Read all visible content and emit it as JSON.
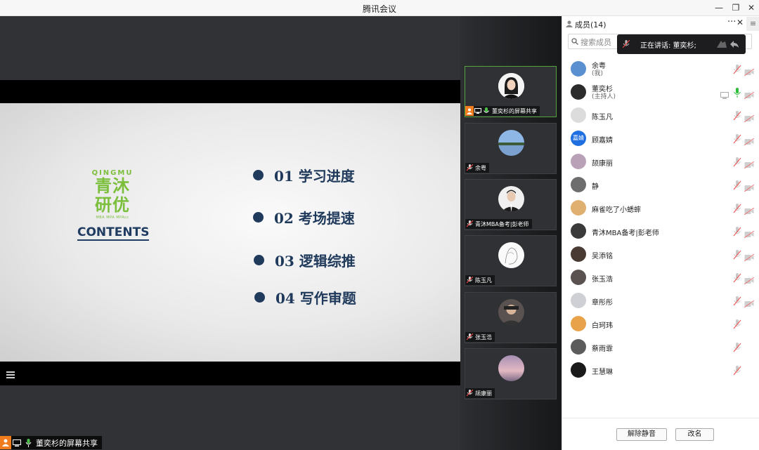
{
  "window": {
    "title": "腾讯会议",
    "minimize": "—",
    "restore": "❐",
    "close": "✕"
  },
  "slide": {
    "logo_en": "QINGMU",
    "logo_cn_1": "青沐",
    "logo_cn_2": "研优",
    "logo_sub": "MBA MPA MPAcc",
    "contents": "CONTENTS",
    "agenda": [
      "01 学习进度",
      "02 考场提速",
      "03 逻辑综推",
      "04 写作审题"
    ]
  },
  "presenter_tag": "董奕杉的屏幕共享",
  "video_strip": [
    {
      "label": "董奕杉的屏幕共享",
      "avatar": "person-woman-avatar",
      "active": true
    },
    {
      "label": "余粤",
      "avatar": "landscape-avatar"
    },
    {
      "label": "青沐MBA备考|彭老师",
      "avatar": "person-man-avatar"
    },
    {
      "label": "陈玉凡",
      "avatar": "sketch-avatar"
    },
    {
      "label": "张玉浩",
      "avatar": "photo-avatar"
    },
    {
      "label": "颉康丽",
      "avatar": "sunset-avatar"
    }
  ],
  "panel": {
    "title": "成员(14)",
    "more": "···",
    "close": "✕",
    "menu": "≡",
    "search_placeholder": "搜索成员",
    "speaking": "正在讲话: 董奕杉;"
  },
  "members": [
    {
      "name": "余粤",
      "role": "(我)",
      "avatar": "landscape-avatar",
      "avatar_color": "#5a8fd0",
      "mic_on": false,
      "cam": true
    },
    {
      "name": "董奕杉",
      "role": "(主持人)",
      "avatar": "person-woman-avatar",
      "avatar_color": "#2c2c2c",
      "mic_on": true,
      "cam": true,
      "screen": true
    },
    {
      "name": "陈玉凡",
      "role": "",
      "avatar": "sketch-avatar",
      "avatar_color": "#dcdcdc",
      "mic_on": false,
      "cam": true
    },
    {
      "name": "顾嘉婧",
      "role": "",
      "avatar": "initials-avatar",
      "avatar_text": "嘉婧",
      "avatar_color": "#1f6fe0",
      "mic_on": false,
      "cam": true
    },
    {
      "name": "颉康丽",
      "role": "",
      "avatar": "sunset-avatar",
      "avatar_color": "#b9a2b8",
      "mic_on": false,
      "cam": true
    },
    {
      "name": "静",
      "role": "",
      "avatar": "photo-avatar",
      "avatar_color": "#6d6d6d",
      "mic_on": false,
      "cam": true
    },
    {
      "name": "麻雀吃了小蟋蟀",
      "role": "",
      "avatar": "cartoon-avatar",
      "avatar_color": "#e0b070",
      "mic_on": false,
      "cam": true
    },
    {
      "name": "青沐MBA备考|彭老师",
      "role": "",
      "avatar": "person-man-avatar",
      "avatar_color": "#3a3a3a",
      "mic_on": false,
      "cam": true
    },
    {
      "name": "吴添铭",
      "role": "",
      "avatar": "photo-avatar",
      "avatar_color": "#4a3a34",
      "mic_on": false,
      "cam": true
    },
    {
      "name": "张玉浩",
      "role": "",
      "avatar": "photo-avatar",
      "avatar_color": "#5a5250",
      "mic_on": false,
      "cam": true
    },
    {
      "name": "章彤彤",
      "role": "",
      "avatar": "photo-avatar",
      "avatar_color": "#cfcfd6",
      "mic_on": false,
      "cam": true
    },
    {
      "name": "白珂玮",
      "role": "",
      "avatar": "photo-avatar",
      "avatar_color": "#e8a24a",
      "mic_on": false,
      "cam": false
    },
    {
      "name": "蔡雨霏",
      "role": "",
      "avatar": "photo-avatar",
      "avatar_color": "#5c5c5c",
      "mic_on": false,
      "cam": false
    },
    {
      "name": "王慧琳",
      "role": "",
      "avatar": "photo-avatar",
      "avatar_color": "#1a1a1a",
      "mic_on": false,
      "cam": false
    }
  ],
  "footer": {
    "unmute_all": "解除静音",
    "rename": "改名"
  },
  "colors": {
    "accent_green": "#56a33d",
    "share_orange": "#f07c1e",
    "slide_navy": "#203a5c",
    "logo_green": "#7bbf3c"
  }
}
